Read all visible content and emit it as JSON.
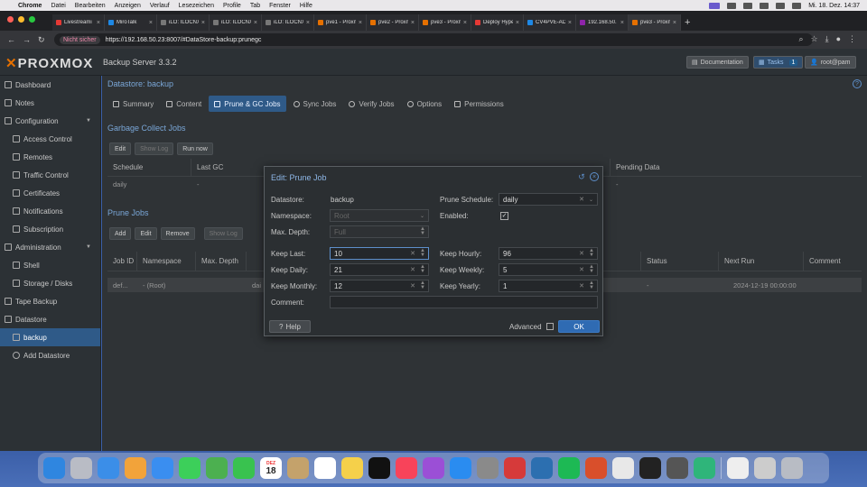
{
  "menubar": {
    "app": "Chrome",
    "items": [
      "Datei",
      "Bearbeiten",
      "Anzeigen",
      "Verlauf",
      "Lesezeichen",
      "Profile",
      "Tab",
      "Fenster",
      "Hilfe"
    ],
    "datetime": "Mi. 18. Dez.  14:37"
  },
  "browser": {
    "tabs": [
      {
        "label": "Livestreami",
        "color": "#e53935"
      },
      {
        "label": "MiroTalk",
        "color": "#1e88e5"
      },
      {
        "label": "iLO: ILOCNX",
        "color": "#777"
      },
      {
        "label": "iLO: ILOCNX",
        "color": "#777"
      },
      {
        "label": "iLO: ILOCNX",
        "color": "#777"
      },
      {
        "label": "pve1 - Proxm",
        "color": "#e57000"
      },
      {
        "label": "pve2 - Proxm",
        "color": "#e57000"
      },
      {
        "label": "pve3 - Proxm",
        "color": "#e57000"
      },
      {
        "label": "Deploy Hype",
        "color": "#e53935"
      },
      {
        "label": "CV4PVE-AD",
        "color": "#1e88e5"
      },
      {
        "label": "192.168.50.",
        "color": "#8e24aa"
      },
      {
        "label": "pve3 - Proxm",
        "color": "#e57000"
      }
    ],
    "not_secure": "Nicht sicher",
    "url": "https://192.168.50.23:8007/#DataStore-backup:prunegc"
  },
  "header": {
    "logo": "PROXMOX",
    "version": "Backup Server 3.3.2",
    "documentation": "Documentation",
    "tasks": "Tasks",
    "tasks_count": "1",
    "user": "root@pam"
  },
  "sidebar": {
    "items": [
      {
        "label": "Dashboard"
      },
      {
        "label": "Notes"
      },
      {
        "label": "Configuration"
      },
      {
        "label": "Access Control"
      },
      {
        "label": "Remotes"
      },
      {
        "label": "Traffic Control"
      },
      {
        "label": "Certificates"
      },
      {
        "label": "Notifications"
      },
      {
        "label": "Subscription"
      },
      {
        "label": "Administration"
      },
      {
        "label": "Shell"
      },
      {
        "label": "Storage / Disks"
      },
      {
        "label": "Tape Backup"
      },
      {
        "label": "Datastore"
      },
      {
        "label": "backup"
      },
      {
        "label": "Add Datastore"
      }
    ]
  },
  "main": {
    "breadcrumb": "Datastore: backup",
    "tabs": [
      "Summary",
      "Content",
      "Prune & GC Jobs",
      "Sync Jobs",
      "Verify Jobs",
      "Options",
      "Permissions"
    ],
    "gc": {
      "title": "Garbage Collect Jobs",
      "buttons": [
        "Edit",
        "Show Log",
        "Run now"
      ],
      "columns": [
        "Schedule",
        "Last GC",
        "Pending Data"
      ],
      "row": {
        "schedule": "daily",
        "last_gc": "-",
        "pending": "-"
      }
    },
    "prune": {
      "title": "Prune Jobs",
      "buttons": [
        "Add",
        "Edit",
        "Remove",
        "Show Log"
      ],
      "columns": [
        "Job ID",
        "Namespace",
        "Max. Depth",
        "Status",
        "Next Run",
        "Comment"
      ],
      "row": {
        "job_id": "def...",
        "namespace": "- (Root)",
        "schedule_frag": "dai",
        "status": "-",
        "next_run": "2024-12-19 00:00:00"
      }
    }
  },
  "dialog": {
    "title": "Edit: Prune Job",
    "labels": {
      "datastore": "Datastore:",
      "namespace": "Namespace:",
      "max_depth": "Max. Depth:",
      "keep_last": "Keep Last:",
      "keep_daily": "Keep Daily:",
      "keep_monthly": "Keep Monthly:",
      "comment": "Comment:",
      "prune_schedule": "Prune Schedule:",
      "enabled": "Enabled:",
      "keep_hourly": "Keep Hourly:",
      "keep_weekly": "Keep Weekly:",
      "keep_yearly": "Keep Yearly:"
    },
    "values": {
      "datastore": "backup",
      "namespace": "Root",
      "max_depth": "Full",
      "keep_last": "10",
      "keep_daily": "21",
      "keep_monthly": "12",
      "comment": "",
      "prune_schedule": "daily",
      "enabled": true,
      "keep_hourly": "96",
      "keep_weekly": "5",
      "keep_yearly": "1"
    },
    "help": "Help",
    "advanced": "Advanced",
    "ok": "OK"
  },
  "dock": {
    "calendar_month": "DEZ",
    "calendar_day": "18",
    "apps": [
      {
        "name": "finder-icon",
        "color": "#2f86e0"
      },
      {
        "name": "launchpad-icon",
        "color": "#b9bcc5"
      },
      {
        "name": "safari-icon",
        "color": "#3b8ee8"
      },
      {
        "name": "photos-icon",
        "color": "#f2a33a"
      },
      {
        "name": "mail-icon",
        "color": "#3a8ef0"
      },
      {
        "name": "messages-icon",
        "color": "#3ccf5a"
      },
      {
        "name": "maps-icon",
        "color": "#4cb050"
      },
      {
        "name": "facetime-icon",
        "color": "#39c24f"
      },
      {
        "name": "calendar-icon",
        "color": "#ffffff"
      },
      {
        "name": "contacts-icon",
        "color": "#c4a26b"
      },
      {
        "name": "reminders-icon",
        "color": "#ffffff"
      },
      {
        "name": "notes-icon",
        "color": "#f5d04a"
      },
      {
        "name": "tv-icon",
        "color": "#111111"
      },
      {
        "name": "music-icon",
        "color": "#f8435a"
      },
      {
        "name": "podcasts-icon",
        "color": "#9b4fd6"
      },
      {
        "name": "app-store-icon",
        "color": "#2a8cf0"
      },
      {
        "name": "system-settings-icon",
        "color": "#8a8a8a"
      },
      {
        "name": "app-icon-red",
        "color": "#d63a3a"
      },
      {
        "name": "app-icon-blue",
        "color": "#2c6fb0"
      },
      {
        "name": "spotify-icon",
        "color": "#1db954"
      },
      {
        "name": "app-icon-orange",
        "color": "#d94f2b"
      },
      {
        "name": "chrome-icon",
        "color": "#e8e8e8"
      },
      {
        "name": "terminal-icon",
        "color": "#222222"
      },
      {
        "name": "calculator-icon",
        "color": "#555555"
      },
      {
        "name": "app-icon-green",
        "color": "#2fb57a"
      },
      {
        "name": "document-icon",
        "color": "#eeeeee"
      },
      {
        "name": "preview-icon",
        "color": "#cccccc"
      },
      {
        "name": "trash-icon",
        "color": "#b8bcc4"
      }
    ]
  }
}
